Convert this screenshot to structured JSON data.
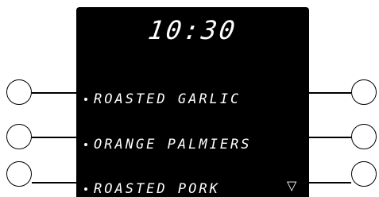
{
  "display": {
    "time": "10:30",
    "menu_items": [
      {
        "label": "ROASTED GARLIC"
      },
      {
        "label": "ORANGE PALMIERS"
      },
      {
        "label": "ROASTED PORK"
      }
    ],
    "scroll_indicator": "▽",
    "scroll_icon": "triangle-down-outline-icon"
  },
  "colors": {
    "panel_background": "#000000",
    "text": "#ffffff",
    "page_background": "#ffffff",
    "key_outline": "#000000"
  }
}
